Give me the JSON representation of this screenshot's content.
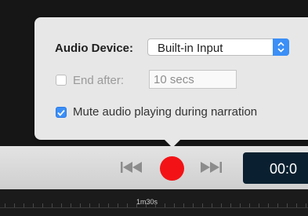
{
  "popover": {
    "audio_device_label": "Audio Device:",
    "audio_device_value": "Built-in Input",
    "end_after_label": "End after:",
    "end_after_placeholder": "10 secs",
    "end_after_checked": false,
    "mute_label": "Mute audio playing during narration",
    "mute_checked": true
  },
  "toolbar": {
    "rewind_icon": "rewind-icon",
    "record_icon": "record-icon",
    "forward_icon": "skip-forward-icon",
    "timecode": "00:0"
  },
  "timeline": {
    "ruler_label": "1m30s"
  },
  "colors": {
    "accent": "#3b8ff6",
    "record": "#f31316",
    "timecode_bg": "#0a2030"
  }
}
